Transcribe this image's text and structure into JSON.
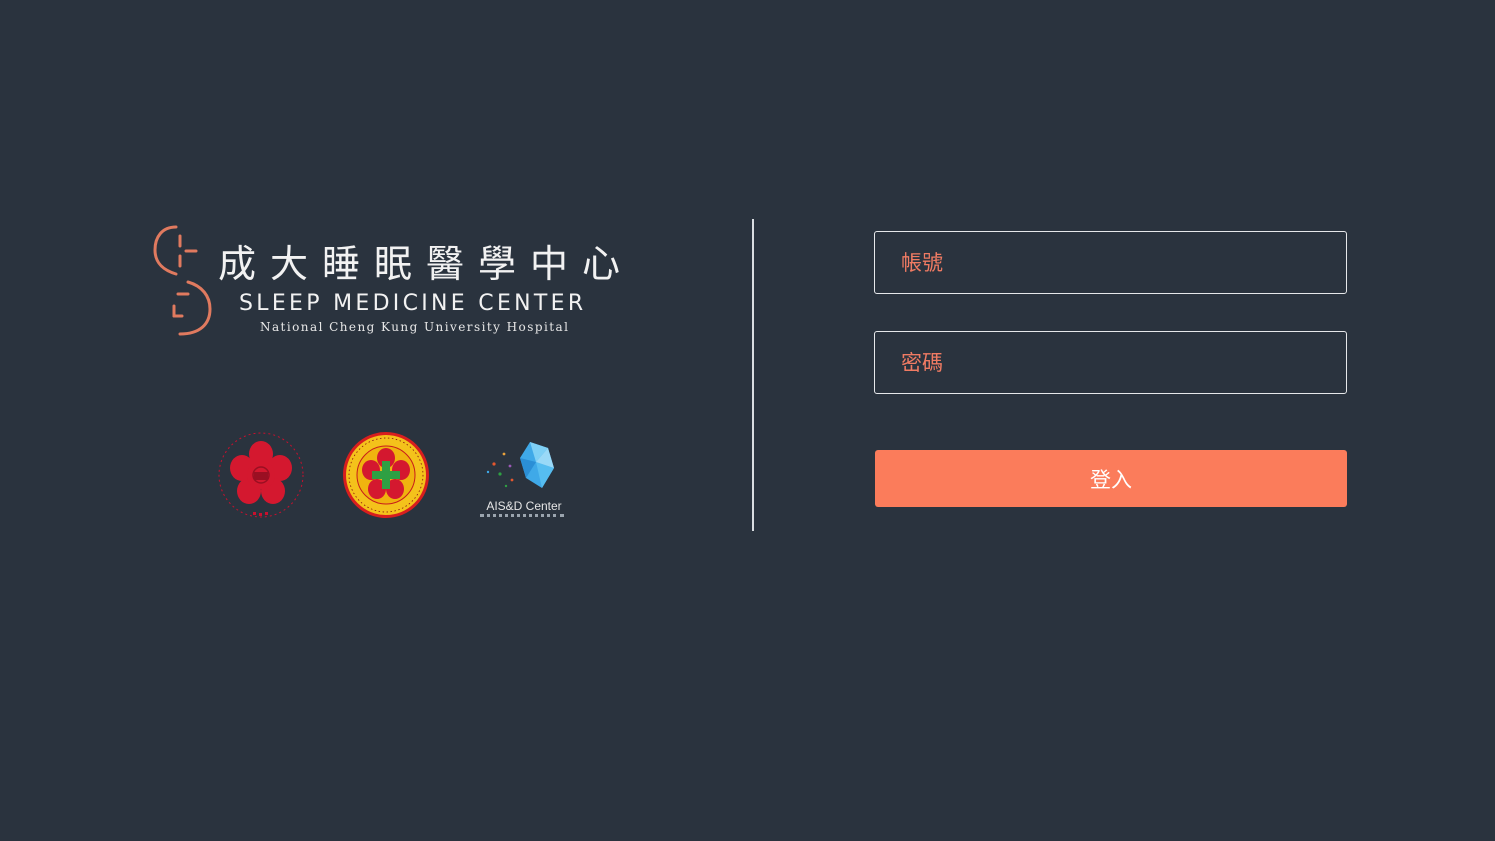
{
  "brand": {
    "name_zh": "成大睡眠醫學中心",
    "name_en": "SLEEP MEDICINE CENTER",
    "subtitle": "National Cheng Kung University Hospital",
    "mark_icon": "sleep-s-logo-icon"
  },
  "logos": {
    "ncku": {
      "icon": "ncku-emblem-icon"
    },
    "hospital": {
      "icon": "ncku-hospital-emblem-icon"
    },
    "aisd": {
      "icon": "aisd-center-logo-icon",
      "label": "AIS&D Center"
    }
  },
  "form": {
    "account_placeholder": "帳號",
    "password_placeholder": "密碼",
    "login_label": "登入"
  },
  "colors": {
    "background": "#2a333e",
    "accent": "#fb7c5b",
    "placeholder": "#f07b63",
    "field_border": "#e6e8ea"
  }
}
